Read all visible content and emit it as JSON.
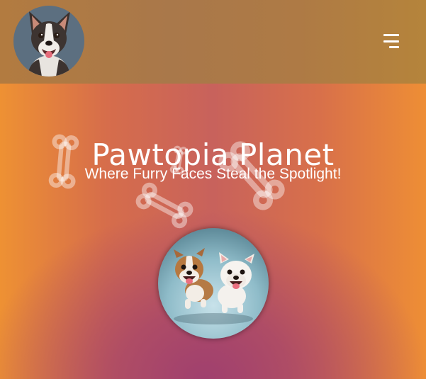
{
  "header": {
    "avatar_icon": "dog-avatar",
    "menu_icon": "hamburger-menu-icon"
  },
  "hero": {
    "title": "Pawtopia Planet",
    "subtitle": "Where Furry Faces Steal the Spotlight!",
    "image_icon": "two-puppies-running-illustration"
  },
  "decorations": {
    "pattern_icon": "dog-bone-icon"
  },
  "colors": {
    "header_bg": "#ad7a45",
    "page_gradient_left": "#ee9133",
    "page_gradient_center": "#c8625c",
    "page_gradient_bottom": "#a0406e",
    "text": "#ffffff"
  }
}
